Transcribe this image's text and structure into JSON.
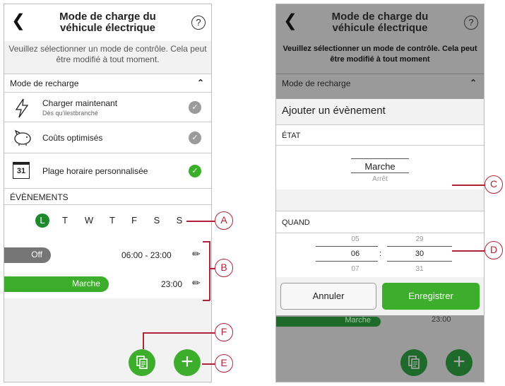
{
  "header": {
    "title": "Mode de charge du véhicule électrique",
    "help_icon": "?"
  },
  "subtitle_left": "Veuillez sélectionner un mode de contrôle. Cela peut être modifié à tout moment.",
  "subtitle_right": "Veuillez sélectionner un mode de contrôle. Cela peut être modifié à tout moment",
  "mode_section": "Mode de recharge",
  "modes": [
    {
      "label": "Charger maintenant",
      "sub": "Dès qu'ilestbranché",
      "icon": "lightning-icon",
      "checked": false
    },
    {
      "label": "Coûts optimisés",
      "sub": "",
      "icon": "piggy-bank-icon",
      "checked": false
    },
    {
      "label": "Plage horaire personnalisée",
      "sub": "",
      "icon": "calendar-icon",
      "checked": true
    }
  ],
  "calendar_day": "31",
  "events_section": "ÉVÈNEMENTS",
  "days": [
    "L",
    "T",
    "W",
    "T",
    "F",
    "S",
    "S"
  ],
  "events": [
    {
      "state": "Off",
      "time": "06:00 - 23:00"
    },
    {
      "state": "Marche",
      "time": "23:00"
    }
  ],
  "dialog": {
    "title": "Ajouter un évènement",
    "state_label": "ÉTAT",
    "state_selected": "Marche",
    "state_next": "Arrêt",
    "when_label": "QUAND",
    "hours": [
      "05",
      "06",
      "07"
    ],
    "minutes": [
      "29",
      "30",
      "31"
    ],
    "separator": ":",
    "cancel": "Annuler",
    "save": "Enregistrer"
  },
  "behind_dialog": {
    "pill": "Marche",
    "time": "23:00"
  },
  "callouts": [
    "A",
    "B",
    "C",
    "D",
    "E",
    "F"
  ],
  "colors": {
    "accent": "#3dae2b",
    "accent_dark": "#1e8a2b",
    "callout": "#b0243a",
    "overlay": "#9a9a9a"
  }
}
